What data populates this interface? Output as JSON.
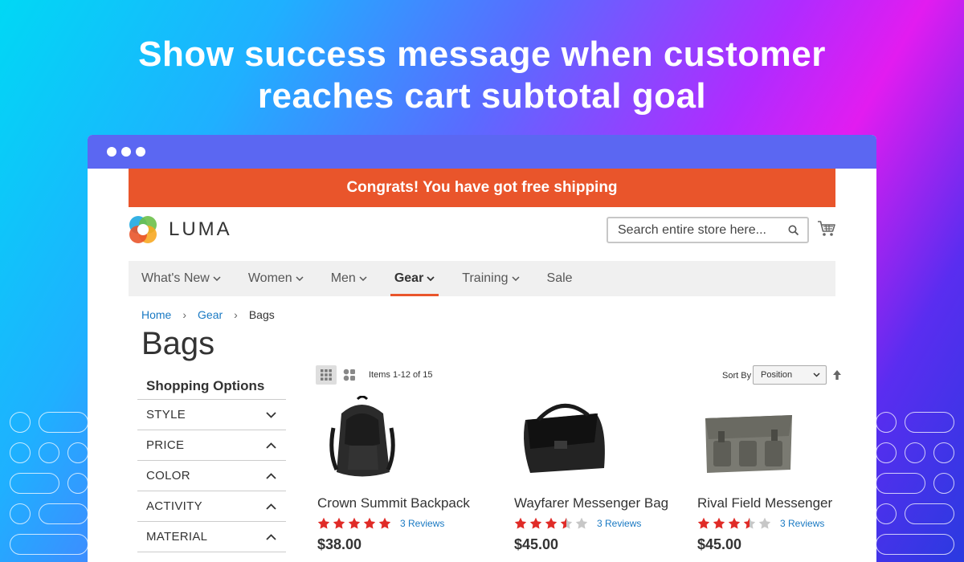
{
  "hero": {
    "line1": "Show success message when customer",
    "line2": "reaches cart subtotal goal"
  },
  "promo": {
    "text": "Congrats! You have got free shipping"
  },
  "logo": {
    "text": "LUMA"
  },
  "search": {
    "placeholder": "Search entire store here..."
  },
  "nav": {
    "items": [
      {
        "label": "What's New"
      },
      {
        "label": "Women"
      },
      {
        "label": "Men"
      },
      {
        "label": "Gear"
      },
      {
        "label": "Training"
      },
      {
        "label": "Sale"
      }
    ],
    "active": "Gear"
  },
  "breadcrumb": {
    "home": "Home",
    "gear": "Gear",
    "current": "Bags"
  },
  "page_title": "Bags",
  "filters": {
    "title": "Shopping Options",
    "items": [
      {
        "label": "STYLE",
        "icon": "chevron-down-icon"
      },
      {
        "label": "PRICE",
        "icon": "chevron-up-icon"
      },
      {
        "label": "COLOR",
        "icon": "chevron-up-icon"
      },
      {
        "label": "ACTIVITY",
        "icon": "chevron-up-icon"
      },
      {
        "label": "MATERIAL",
        "icon": "chevron-up-icon"
      }
    ]
  },
  "toolbar": {
    "amount": "Items 1-12 of 15",
    "sort_label": "Sort By",
    "sort_value": "Position"
  },
  "products": [
    {
      "name": "Crown Summit Backpack",
      "rating": 5,
      "reviews": "3 Reviews",
      "price": "$38.00"
    },
    {
      "name": "Wayfarer Messenger Bag",
      "rating": 3.5,
      "reviews": "3 Reviews",
      "price": "$45.00"
    },
    {
      "name": "Rival Field Messenger",
      "rating": 3.5,
      "reviews": "3 Reviews",
      "price": "$45.00"
    }
  ],
  "colors": {
    "promo": "#e9552b",
    "browser_bar": "#5b67f2",
    "link": "#1979c3",
    "star": "#e02b27"
  }
}
